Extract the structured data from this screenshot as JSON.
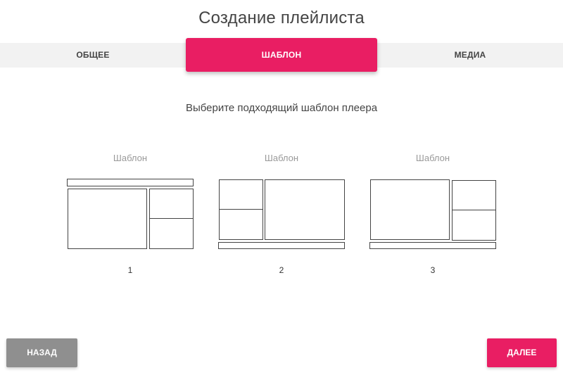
{
  "page": {
    "title": "Создание плейлиста"
  },
  "tabs": [
    {
      "label": "ОБЩЕЕ",
      "active": false
    },
    {
      "label": "ШАБЛОН",
      "active": true
    },
    {
      "label": "МЕДИА",
      "active": false
    }
  ],
  "main": {
    "subtitle": "Выберите подходящий шаблон плеера",
    "templates": [
      {
        "label": "Шаблон",
        "number": "1"
      },
      {
        "label": "Шаблон",
        "number": "2"
      },
      {
        "label": "Шаблон",
        "number": "3"
      }
    ]
  },
  "footer": {
    "back_label": "НАЗАД",
    "next_label": "ДАЛЕЕ"
  },
  "colors": {
    "accent": "#e91e63",
    "back_button": "#8f8f8f",
    "tabbar": "#f2f2f2"
  }
}
